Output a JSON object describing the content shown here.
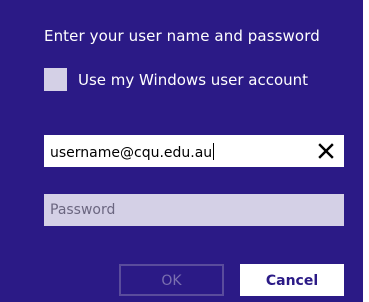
{
  "dialog": {
    "title": "Enter your user name and password",
    "use_windows_account": {
      "label": "Use my Windows user account",
      "checked": false
    },
    "username": {
      "value": "username@cqu.edu.au",
      "clear_icon": "close-icon"
    },
    "password": {
      "placeholder": "Password",
      "value": ""
    },
    "buttons": {
      "ok_label": "OK",
      "cancel_label": "Cancel"
    }
  },
  "colors": {
    "background": "#2b1a86",
    "field_inactive": "#d4d0e6",
    "disabled_button_border": "#5a4c9c",
    "disabled_button_text": "#7b70b0"
  }
}
